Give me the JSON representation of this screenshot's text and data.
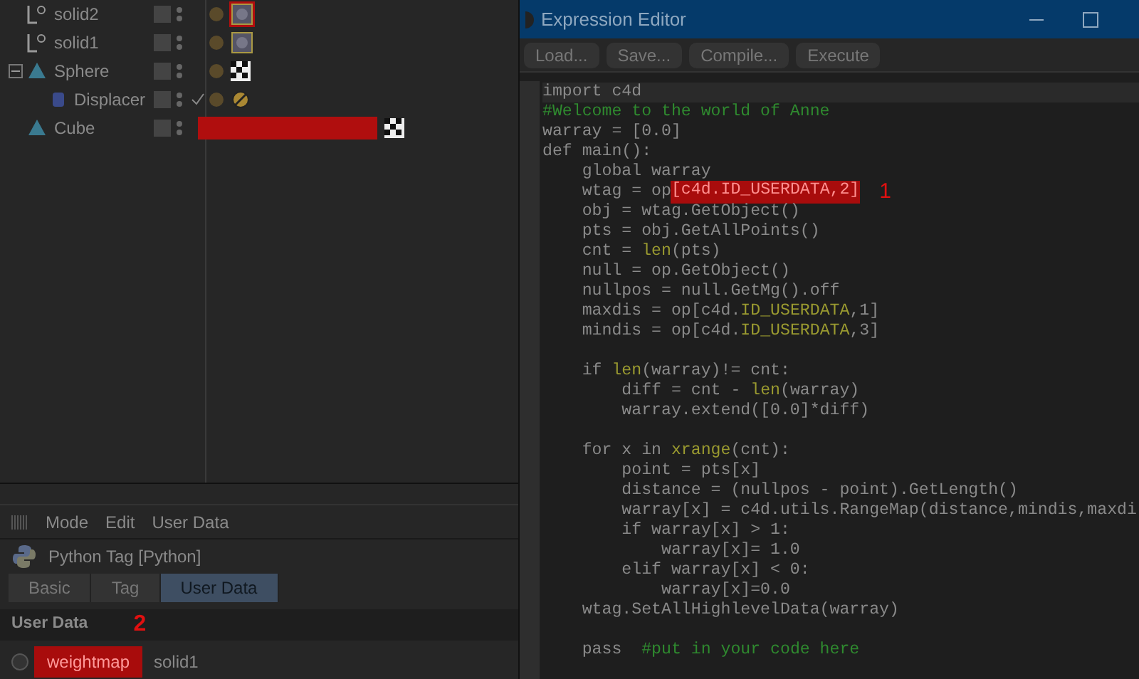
{
  "objects": [
    {
      "name": "solid2",
      "kind": "null",
      "tags": [
        {
          "kind": "python",
          "marked": true
        }
      ]
    },
    {
      "name": "solid1",
      "kind": "null",
      "tags": [
        {
          "kind": "python",
          "marked": false
        }
      ]
    },
    {
      "name": "Sphere",
      "kind": "primitive",
      "expanded": true,
      "tags": [
        {
          "kind": "texture",
          "marked": false
        }
      ],
      "children": [
        {
          "name": "Displacer",
          "kind": "deformer",
          "checked": true,
          "tags": [
            {
              "kind": "restrict",
              "marked": false
            }
          ]
        }
      ]
    },
    {
      "name": "Cube",
      "kind": "primitive",
      "tags": [
        {
          "kind": "texture",
          "marked": false
        }
      ],
      "marked_strip": true
    }
  ],
  "editor": {
    "title": "Expression Editor",
    "buttons": [
      "Load...",
      "Save...",
      "Compile...",
      "Execute"
    ],
    "lines": [
      {
        "segments": [
          {
            "text": "import c4d",
            "kind": "plain"
          }
        ]
      },
      {
        "segments": [
          {
            "text": "#Welcome to the world of Anne",
            "kind": "comment"
          }
        ]
      },
      {
        "segments": [
          {
            "text": "warray = [0.0]",
            "kind": "plain"
          }
        ]
      },
      {
        "segments": [
          {
            "text": "def main():",
            "kind": "plain"
          }
        ]
      },
      {
        "segments": [
          {
            "text": "    global warray",
            "kind": "plain"
          }
        ]
      },
      {
        "segments": [
          {
            "text": "    wtag = op",
            "kind": "plain"
          },
          {
            "text": "[c4d.ID_USERDATA,2]",
            "kind": "marked",
            "marker": "1"
          }
        ]
      },
      {
        "segments": [
          {
            "text": "    obj = wtag.GetObject()",
            "kind": "plain"
          }
        ]
      },
      {
        "segments": [
          {
            "text": "    pts = obj.GetAllPoints()",
            "kind": "plain"
          }
        ]
      },
      {
        "segments": [
          {
            "text": "    cnt = ",
            "kind": "plain"
          },
          {
            "text": "len",
            "kind": "builtin"
          },
          {
            "text": "(pts)",
            "kind": "plain"
          }
        ]
      },
      {
        "segments": [
          {
            "text": "    null = op.GetObject()",
            "kind": "plain"
          }
        ]
      },
      {
        "segments": [
          {
            "text": "    nullpos = null.GetMg().off",
            "kind": "plain"
          }
        ]
      },
      {
        "segments": [
          {
            "text": "    maxdis = op[c4d.",
            "kind": "plain"
          },
          {
            "text": "ID_USERDATA",
            "kind": "builtin"
          },
          {
            "text": ",1]",
            "kind": "plain"
          }
        ]
      },
      {
        "segments": [
          {
            "text": "    mindis = op[c4d.",
            "kind": "plain"
          },
          {
            "text": "ID_USERDATA",
            "kind": "builtin"
          },
          {
            "text": ",3]",
            "kind": "plain"
          }
        ],
        "gap_after": true
      },
      {
        "segments": [
          {
            "text": "    if ",
            "kind": "plain"
          },
          {
            "text": "len",
            "kind": "builtin"
          },
          {
            "text": "(warray)!= cnt:",
            "kind": "plain"
          }
        ]
      },
      {
        "segments": [
          {
            "text": "        diff = cnt - ",
            "kind": "plain"
          },
          {
            "text": "len",
            "kind": "builtin"
          },
          {
            "text": "(warray)",
            "kind": "plain"
          }
        ]
      },
      {
        "segments": [
          {
            "text": "        warray.extend([0.0]*diff)",
            "kind": "plain"
          }
        ],
        "gap_after": true
      },
      {
        "segments": [
          {
            "text": "    for x in ",
            "kind": "plain"
          },
          {
            "text": "xrange",
            "kind": "builtin"
          },
          {
            "text": "(cnt):",
            "kind": "plain"
          }
        ]
      },
      {
        "segments": [
          {
            "text": "        point = pts[x]",
            "kind": "plain"
          }
        ]
      },
      {
        "segments": [
          {
            "text": "        distance = (nullpos - point).GetLength()",
            "kind": "plain"
          }
        ]
      },
      {
        "segments": [
          {
            "text": "        warray[x] = c4d.utils.RangeMap(distance,mindis,maxdi",
            "kind": "plain"
          }
        ]
      },
      {
        "segments": [
          {
            "text": "        if warray[x] > 1:",
            "kind": "plain"
          }
        ]
      },
      {
        "segments": [
          {
            "text": "            warray[x]= 1.0",
            "kind": "plain"
          }
        ]
      },
      {
        "segments": [
          {
            "text": "        elif warray[x] < 0:",
            "kind": "plain"
          }
        ]
      },
      {
        "segments": [
          {
            "text": "            warray[x]=0.0",
            "kind": "plain"
          }
        ]
      },
      {
        "segments": [
          {
            "text": "    wtag.SetAllHighlevelData(warray)",
            "kind": "plain"
          }
        ],
        "gap_after": true
      },
      {
        "segments": [
          {
            "text": "    pass  ",
            "kind": "plain"
          },
          {
            "text": "#put in your code here",
            "kind": "comment"
          }
        ]
      }
    ]
  },
  "attributes": {
    "menu": [
      "Mode",
      "Edit",
      "User Data"
    ],
    "title": "Python Tag [Python]",
    "tabs": [
      {
        "label": "Basic",
        "selected": false
      },
      {
        "label": "Tag",
        "selected": false
      },
      {
        "label": "User Data",
        "selected": true
      }
    ],
    "section": "User Data",
    "section_marker": "2",
    "fields": [
      {
        "label": "weightmap",
        "value": "solid1",
        "marked": true,
        "selected": false
      }
    ]
  }
}
